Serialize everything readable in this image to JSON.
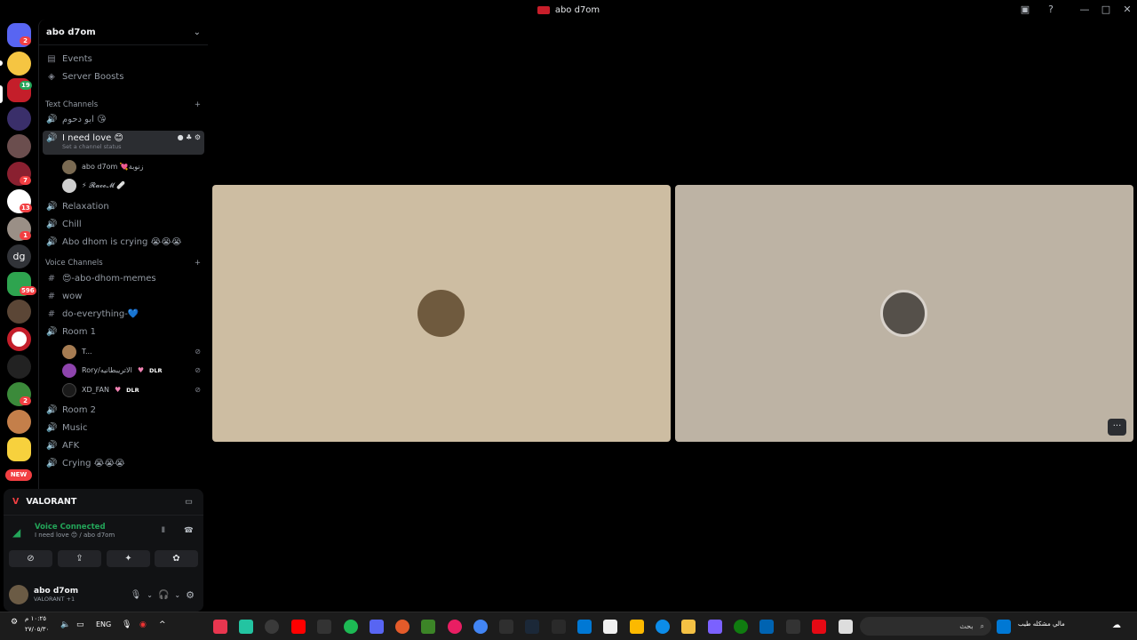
{
  "window": {
    "title": "abo d7om",
    "controls": [
      "inbox-icon",
      "help-icon",
      "minimize-icon",
      "maximize-icon",
      "close-icon"
    ]
  },
  "guilds": {
    "badges": [
      "2",
      "19",
      "7",
      "13",
      "1",
      "596",
      "2"
    ],
    "dm_label": "dg",
    "new_label": "NEW"
  },
  "server": {
    "name": "abo d7om",
    "top_items": [
      "Events",
      "Server Boosts"
    ],
    "text_category": "Text Channels",
    "voice_category": "Voice Channels",
    "channels": {
      "c1": "ابو دحوم 😘",
      "c2": "I need love 😊",
      "c2_status": "Set a channel status",
      "c3": "Relaxation",
      "c4": "Chill",
      "c5": "Abo dhom is crying 😭😭😭",
      "c6": "😍-abo-dhom-memes",
      "c7": "wow",
      "c8": "do-everything-💙",
      "c9": "Room 1",
      "c10": "Room 2",
      "c11": "Music",
      "c12": "AFK",
      "c13": "Crying 😭😭😭"
    },
    "love_users": [
      "abo d7om 💘زنوبة",
      "⚡ 𝓡𝓪𝓸𝓸𝓜 🩹"
    ],
    "room1_users": [
      "T...",
      "Rory/الاتريبطانيه",
      "XD_FAN"
    ],
    "room1_tag": "DLR"
  },
  "panel": {
    "activity": "VALORANT",
    "voice_status": "Voice Connected",
    "voice_location": "I need love 😊 / abo d7om",
    "user_name": "abo d7om",
    "user_sub": "VALORANT +1"
  },
  "taskbar": {
    "time": "١٠:٢٥ م",
    "date": "٢٧/٠٥/٣٠",
    "lang": "ENG",
    "search_placeholder": "بحث",
    "weather": "مالي مشكله طيب"
  },
  "colors": {
    "accent_red": "#f23f42",
    "voice_green": "#23a559",
    "tile_left": "#cdbda2",
    "tile_right": "#bdb3a4"
  }
}
